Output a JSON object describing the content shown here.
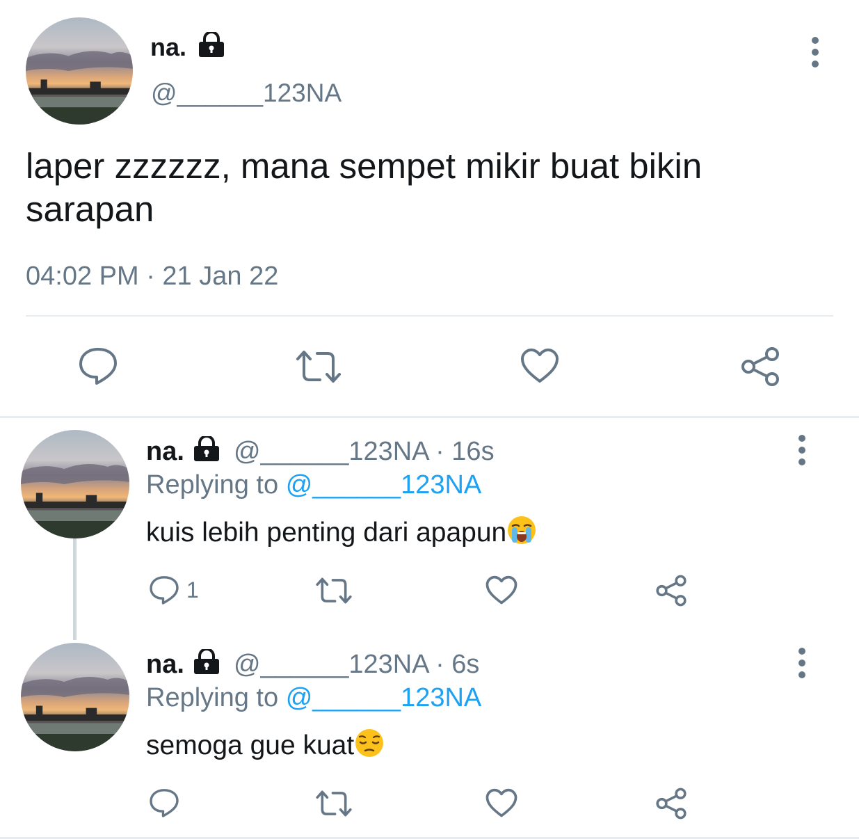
{
  "main_tweet": {
    "display_name": "na.",
    "handle": "@______123NA",
    "text": "laper zzzzzz, mana sempet mikir buat bikin sarapan",
    "timestamp": "04:02 PM · 21 Jan 22"
  },
  "replies": [
    {
      "display_name": "na.",
      "handle": "@______123NA",
      "time": "16s",
      "replying_prefix": "Replying to",
      "replying_to": "@______123NA",
      "text": "kuis lebih penting dari apapun",
      "emoji": "loudly-crying-face",
      "reply_count": "1"
    },
    {
      "display_name": "na.",
      "handle": "@______123NA",
      "time": "6s",
      "replying_prefix": "Replying to",
      "replying_to": "@______123NA",
      "text": "semoga gue kuat",
      "emoji": "pensive-face",
      "reply_count": ""
    }
  ],
  "separator": " · ",
  "icons": [
    "lock-icon",
    "more-icon",
    "reply-icon",
    "retweet-icon",
    "like-icon",
    "share-icon"
  ],
  "colors": {
    "text": "#14171a",
    "secondary": "#657786",
    "link": "#1da1f2",
    "divider": "#e6ecf0"
  }
}
